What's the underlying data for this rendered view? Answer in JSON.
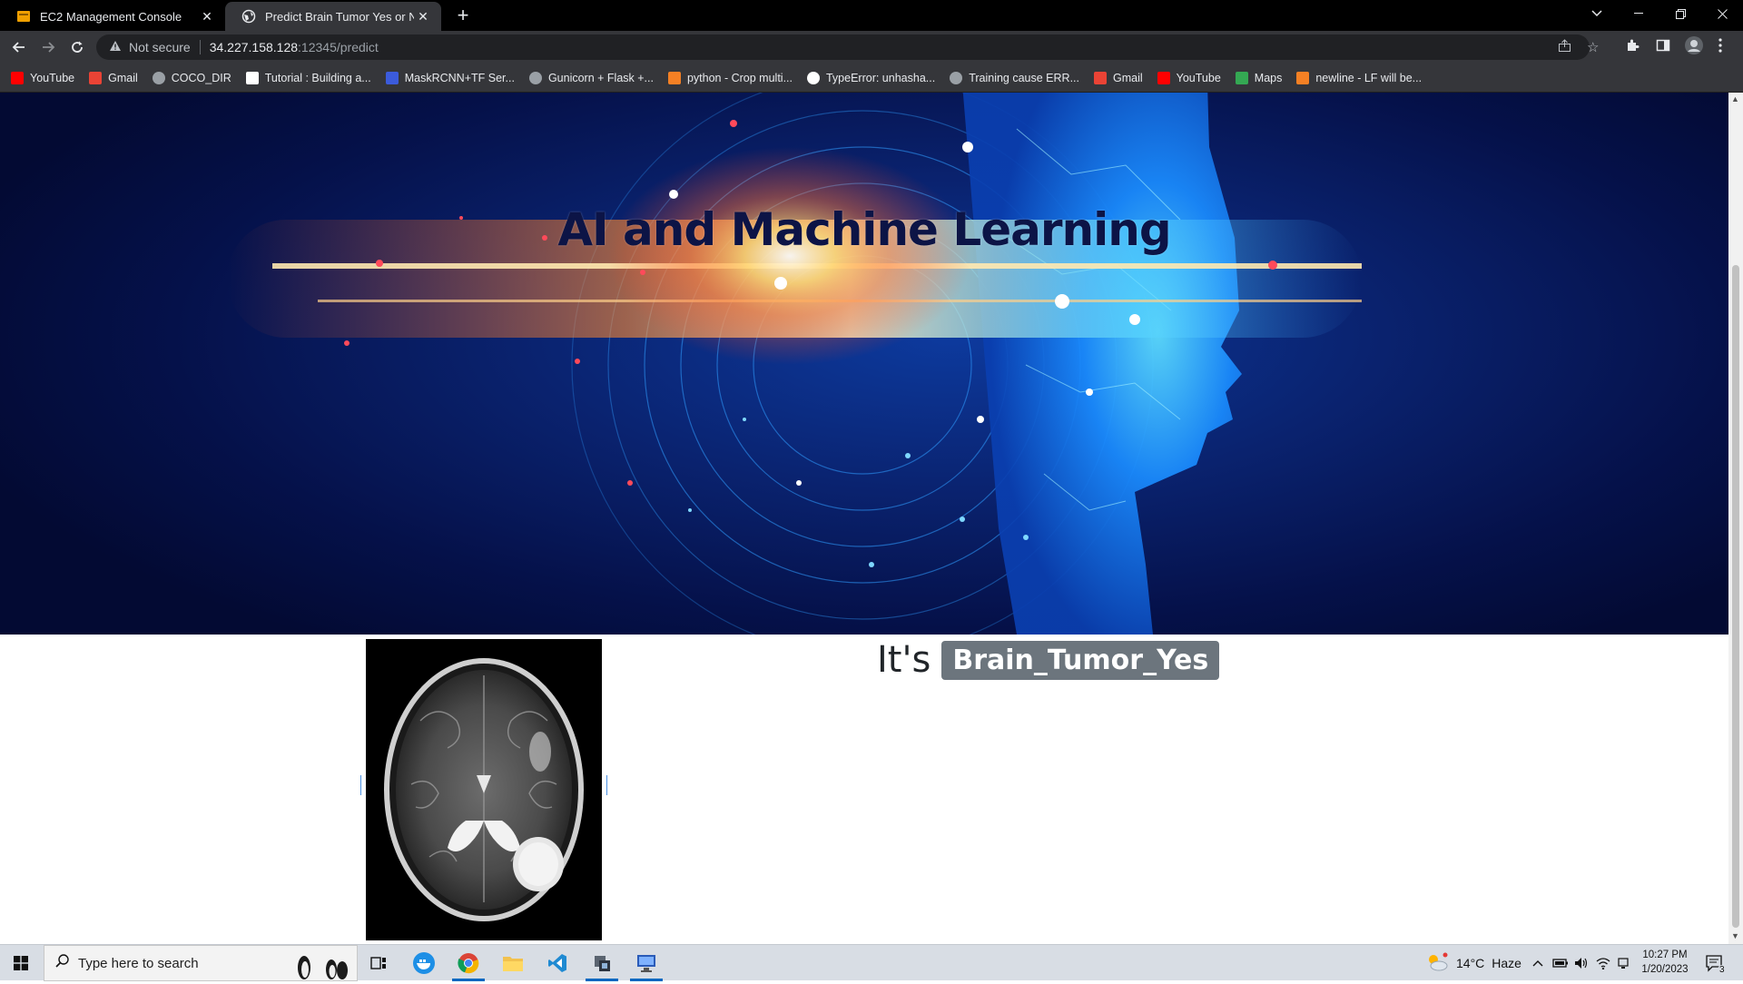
{
  "browser": {
    "tabs": [
      {
        "title": "EC2 Management Console",
        "active": false
      },
      {
        "title": "Predict Brain Tumor Yes or Not D",
        "active": true
      }
    ],
    "new_tab": "+",
    "address": {
      "security_label": "Not secure",
      "host": "34.227.158.128",
      "path": ":12345/predict"
    },
    "bookmarks": [
      {
        "label": "YouTube",
        "icon": "youtube-icon",
        "color": "#ff0000"
      },
      {
        "label": "Gmail",
        "icon": "gmail-icon",
        "color": "#ea4335"
      },
      {
        "label": "COCO_DIR",
        "icon": "github-icon",
        "color": "#9aa0a6"
      },
      {
        "label": "Tutorial : Building a...",
        "icon": "medium-icon",
        "color": "#ffffff"
      },
      {
        "label": "MaskRCNN+TF Ser...",
        "icon": "site-icon",
        "color": "#3b5bdb"
      },
      {
        "label": "Gunicorn + Flask +...",
        "icon": "github-icon",
        "color": "#9aa0a6"
      },
      {
        "label": "python - Crop multi...",
        "icon": "stackoverflow-icon",
        "color": "#f48024"
      },
      {
        "label": "TypeError: unhasha...",
        "icon": "github-icon",
        "color": "#ffffff"
      },
      {
        "label": "Training cause ERR...",
        "icon": "github-icon",
        "color": "#9aa0a6"
      },
      {
        "label": "Gmail",
        "icon": "gmail-icon",
        "color": "#ea4335"
      },
      {
        "label": "YouTube",
        "icon": "youtube-icon",
        "color": "#ff0000"
      },
      {
        "label": "Maps",
        "icon": "maps-icon",
        "color": "#34a853"
      },
      {
        "label": "newline - LF will be...",
        "icon": "stackoverflow-icon",
        "color": "#f48024"
      }
    ]
  },
  "page": {
    "hero_title": "AI and Machine Learning",
    "result_prefix": "It's",
    "result_label": "Brain_Tumor_Yes",
    "badge_color": "#6c757d"
  },
  "taskbar": {
    "search_placeholder": "Type here to search",
    "weather": {
      "temp": "14°C",
      "condition": "Haze"
    },
    "clock": {
      "time": "10:27 PM",
      "date": "1/20/2023"
    },
    "notification_count": "3"
  }
}
